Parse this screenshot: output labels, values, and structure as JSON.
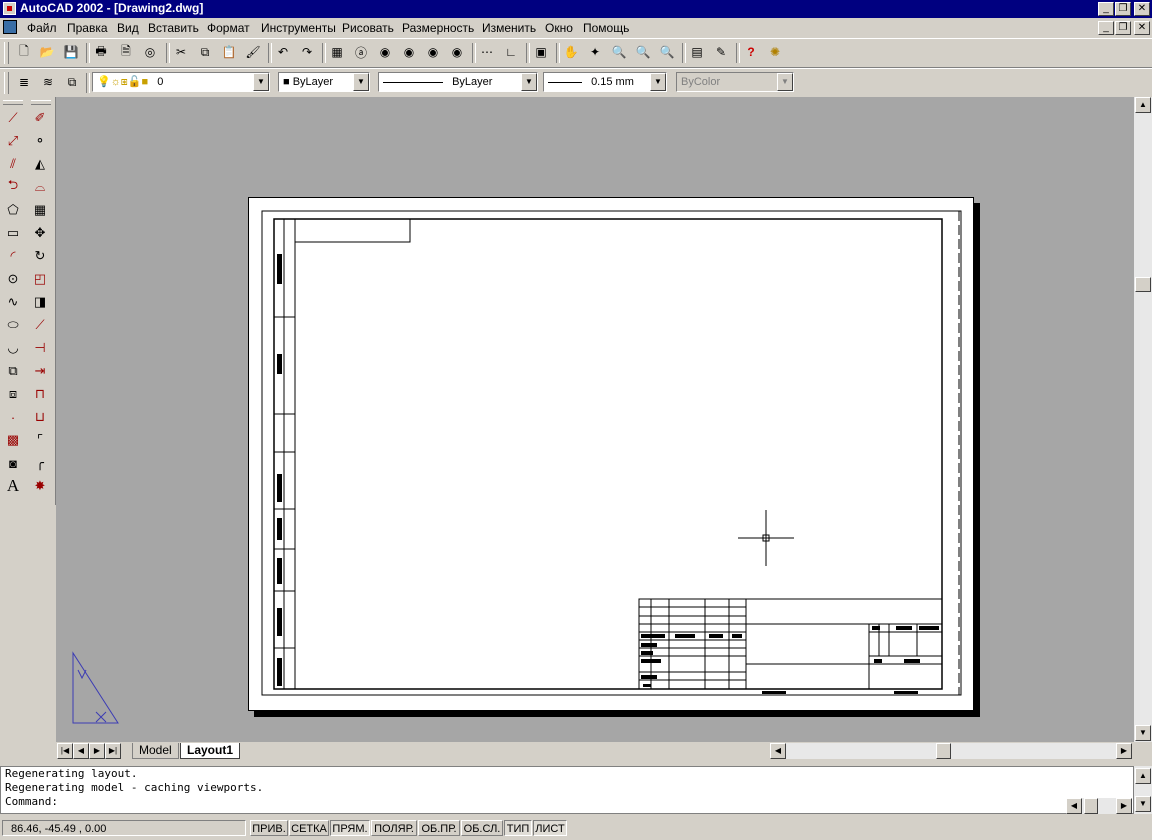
{
  "window": {
    "title": "AutoCAD 2002 - [Drawing2.dwg]",
    "controls": [
      "_",
      "❐",
      "✕"
    ]
  },
  "menu": {
    "items": [
      "Файл",
      "Правка",
      "Вид",
      "Вставить",
      "Формат",
      "Инструменты",
      "Рисовать",
      "Размерность",
      "Изменить",
      "Окно",
      "Помощь"
    ]
  },
  "properties": {
    "layer": "0",
    "color": "ByLayer",
    "linetype": "ByLayer",
    "lineweight": "0.15 mm",
    "plotstyle": "ByColor"
  },
  "tabs": {
    "model": "Model",
    "layout": "Layout1"
  },
  "command": {
    "lines": [
      "Regenerating layout.",
      "Regenerating model - caching viewports."
    ],
    "prompt": "Command:"
  },
  "status": {
    "coords": "86.46, -45.49 , 0.00",
    "buttons": [
      {
        "label": "ПРИВ.",
        "on": false
      },
      {
        "label": "СЕТКА",
        "on": false
      },
      {
        "label": "ПРЯМ.",
        "on": true
      },
      {
        "label": "ПОЛЯР.",
        "on": false
      },
      {
        "label": "ОБ.ПР.",
        "on": false
      },
      {
        "label": "ОБ.СЛ.",
        "on": false
      },
      {
        "label": "ТИП",
        "on": true
      },
      {
        "label": "ЛИСТ",
        "on": true
      }
    ]
  },
  "colors": {
    "titlebar": "#000080",
    "workspace": "#a6a6a6",
    "paper": "#ffffff",
    "ucs_icon": "#3c3cb4"
  }
}
